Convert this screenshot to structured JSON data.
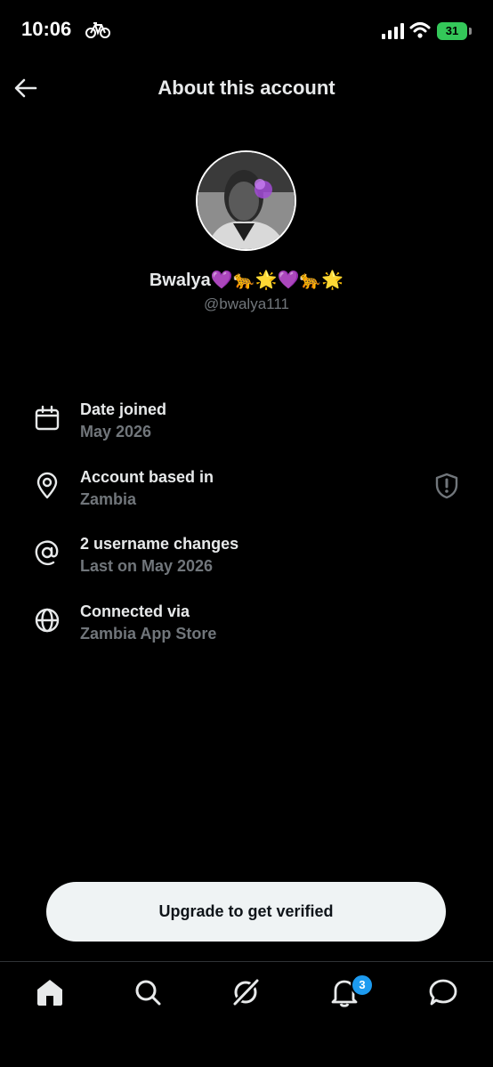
{
  "status_bar": {
    "time": "10:06",
    "battery": "31"
  },
  "header": {
    "title": "About this account"
  },
  "profile": {
    "name": "Bwalya💜🐆🌟💜🐆🌟",
    "handle": "@bwalya111"
  },
  "details": [
    {
      "label": "Date joined",
      "value": "May 2026",
      "icon": "calendar-icon"
    },
    {
      "label": "Account based in",
      "value": "Zambia",
      "icon": "location-pin-icon"
    },
    {
      "label": "2 username changes",
      "value": "Last on May 2026",
      "icon": "at-sign-icon"
    },
    {
      "label": "Connected via",
      "value": "Zambia App Store",
      "icon": "globe-icon"
    }
  ],
  "upgrade_label": "Upgrade to get verified",
  "tabbar": {
    "notifications_badge": "3"
  },
  "colors": {
    "background": "#000000",
    "text_primary": "#e7e9ea",
    "text_secondary": "#71767b",
    "accent": "#1d9bf0",
    "button_bg": "#eff3f4"
  }
}
